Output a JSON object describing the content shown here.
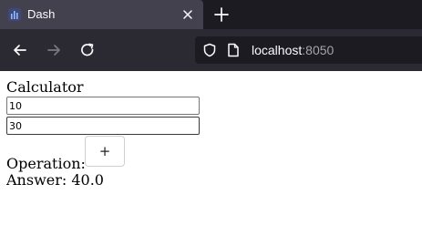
{
  "browser": {
    "tab_title": "Dash",
    "tab_favicon": "dash-bars-icon",
    "url_host": "localhost",
    "url_port": ":8050",
    "chrome_bg": "#2b2a33",
    "tabbar_bg": "#1c1b22"
  },
  "page": {
    "heading": "Calculator",
    "input_a": {
      "value": "10"
    },
    "input_b": {
      "value": "30"
    },
    "operation_label": "Operation:",
    "operation_button": "+",
    "answer": "Answer: 40.0"
  }
}
